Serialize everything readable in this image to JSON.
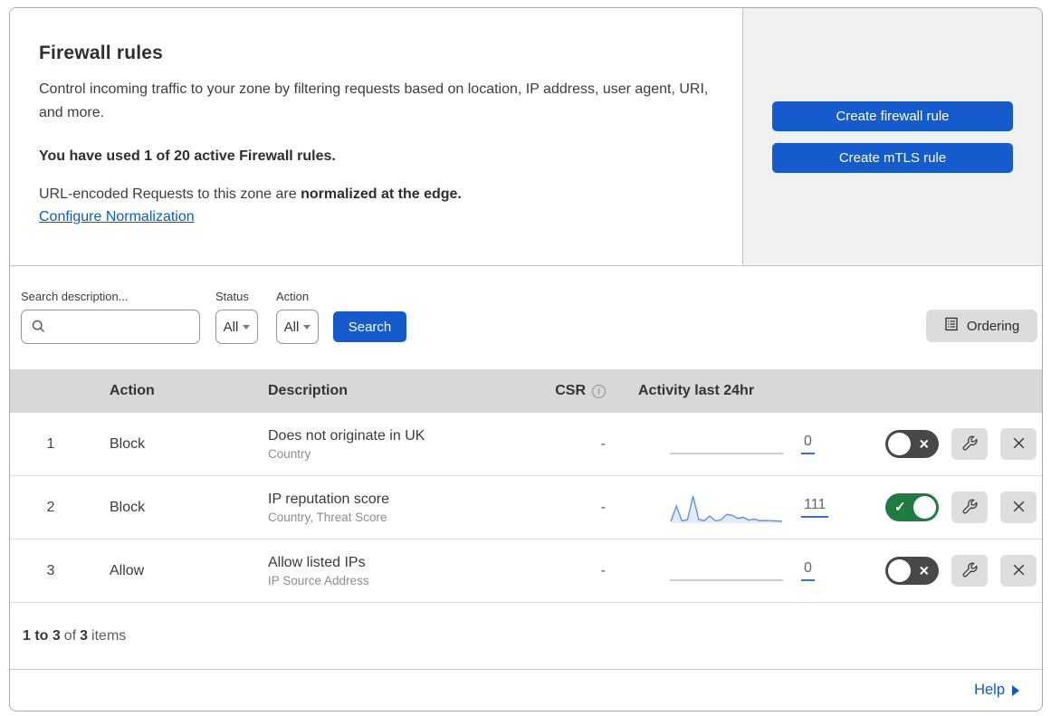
{
  "header": {
    "title": "Firewall rules",
    "description": "Control incoming traffic to your zone by filtering requests based on location, IP address, user agent, URI, and more.",
    "usage_notice": "You have used 1 of 20 active Firewall rules.",
    "normalization_prefix": "URL-encoded Requests to this zone are ",
    "normalization_bold": "normalized at the edge.",
    "normalization_link": "Configure Normalization",
    "buttons": {
      "create_firewall_rule": "Create firewall rule",
      "create_mtls_rule": "Create mTLS rule"
    }
  },
  "filters": {
    "search_label": "Search description...",
    "search_value": "",
    "status_label": "Status",
    "status_value": "All",
    "action_label": "Action",
    "action_value": "All",
    "search_button": "Search",
    "ordering_button": "Ordering"
  },
  "table": {
    "columns": {
      "action": "Action",
      "description": "Description",
      "csr": "CSR",
      "activity": "Activity last 24hr"
    },
    "rows": [
      {
        "index": "1",
        "action": "Block",
        "description": "Does not originate in UK",
        "fields": "Country",
        "csr": "-",
        "count": "0",
        "enabled": false,
        "sparkline": null
      },
      {
        "index": "2",
        "action": "Block",
        "description": "IP reputation score",
        "fields": "Country, Threat Score",
        "csr": "-",
        "count": "111",
        "enabled": true,
        "sparkline": [
          3,
          62,
          5,
          10,
          100,
          11,
          6,
          24,
          6,
          9,
          30,
          27,
          15,
          19,
          9,
          12,
          6,
          7,
          6,
          5,
          4
        ]
      },
      {
        "index": "3",
        "action": "Allow",
        "description": "Allow listed IPs",
        "fields": "IP Source Address",
        "csr": "-",
        "count": "0",
        "enabled": false,
        "sparkline": null
      }
    ]
  },
  "footer": {
    "range": "1 to 3",
    "of_text": "of",
    "total": "3",
    "items_text": "items"
  },
  "help": {
    "label": "Help"
  },
  "colors": {
    "primary_blue": "#155bcd",
    "link_blue": "#0d5bc6",
    "toggle_on_green": "#1e7b41",
    "toggle_off_gray": "#48484b",
    "sparkline_blue": "#5f8fe8",
    "table_header_gray": "#d8d8d8",
    "cta_panel_gray": "#f1f1f1"
  }
}
